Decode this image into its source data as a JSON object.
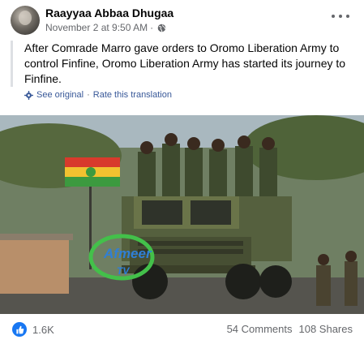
{
  "post": {
    "author": "Raayyaa Abbaa Dhugaa",
    "timestamp": "November 2 at 9:50 AM",
    "separator": "·",
    "privacy_icon": "globe-icon",
    "text": "After Comrade Marro gave orders to Oromo Liberation Army to control Finfine, Oromo Liberation Army has started its journey to Finfine.",
    "see_original": "See original",
    "translate_separator": "·",
    "rate_translation": "Rate this translation"
  },
  "photo": {
    "watermark_line1": "Afmeer",
    "watermark_line2": "TV",
    "flag_colors": [
      "#d83a2c",
      "#3c9a3f",
      "#f2c230"
    ]
  },
  "engagement": {
    "reaction_icon": "like-icon",
    "reaction_count": "1.6K",
    "comments": "54 Comments",
    "shares": "108 Shares"
  },
  "colors": {
    "link": "#385898",
    "secondary_text": "#65676b",
    "like_blue": "#1877f2"
  }
}
